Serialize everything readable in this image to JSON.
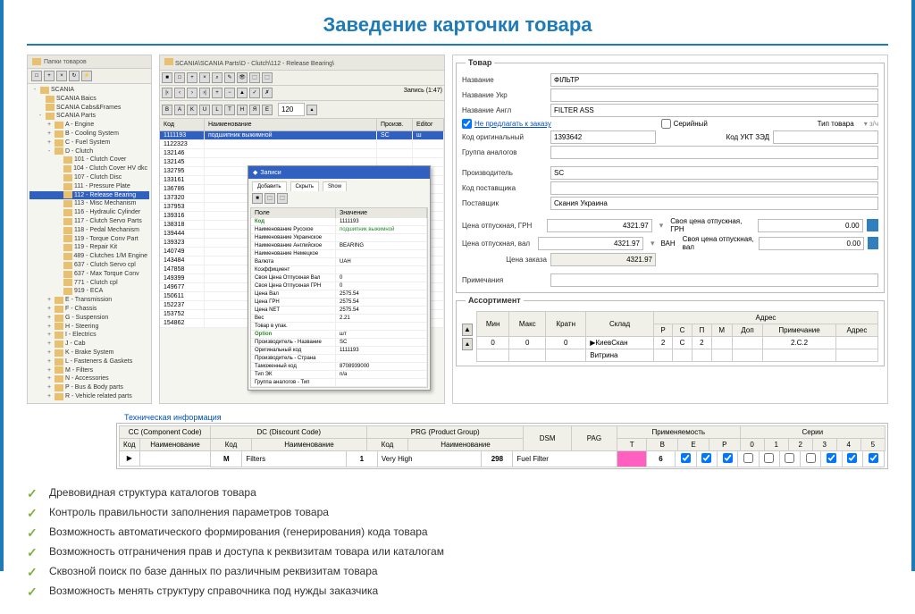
{
  "slide": {
    "title": "Заведение карточки товара"
  },
  "tree_panel": {
    "header": "Папки товаров",
    "root": "SCANIA",
    "items": [
      {
        "label": "SCANIA Baics",
        "level": 1,
        "exp": ""
      },
      {
        "label": "SCANIA Cabs&Frames",
        "level": 1,
        "exp": ""
      },
      {
        "label": "SCANIA Parts",
        "level": 1,
        "exp": "-"
      },
      {
        "label": "A - Engine",
        "level": 2,
        "exp": "+"
      },
      {
        "label": "B - Cooling System",
        "level": 2,
        "exp": "+"
      },
      {
        "label": "C - Fuel System",
        "level": 2,
        "exp": "+"
      },
      {
        "label": "D - Clutch",
        "level": 2,
        "exp": "-"
      },
      {
        "label": "101 - Clutch Cover",
        "level": 3,
        "exp": ""
      },
      {
        "label": "104 - Clutch Cover HV dkc",
        "level": 3,
        "exp": ""
      },
      {
        "label": "107 - Clutch Disc",
        "level": 3,
        "exp": ""
      },
      {
        "label": "111 - Pressure Plate",
        "level": 3,
        "exp": ""
      },
      {
        "label": "112 - Release Bearing",
        "level": 3,
        "exp": "",
        "selected": true
      },
      {
        "label": "113 - Misc Mechanism",
        "level": 3,
        "exp": ""
      },
      {
        "label": "116 - Hydraulic Cylinder",
        "level": 3,
        "exp": ""
      },
      {
        "label": "117 - Clutch Servo Parts",
        "level": 3,
        "exp": ""
      },
      {
        "label": "118 - Pedal Mechanism",
        "level": 3,
        "exp": ""
      },
      {
        "label": "119 - Torque Conv Part",
        "level": 3,
        "exp": ""
      },
      {
        "label": "119 - Repair Kit",
        "level": 3,
        "exp": ""
      },
      {
        "label": "489 - Clutches 1/M Engine",
        "level": 3,
        "exp": ""
      },
      {
        "label": "637 - Clutch Servo cpl",
        "level": 3,
        "exp": ""
      },
      {
        "label": "637 - Max Torque Conv",
        "level": 3,
        "exp": ""
      },
      {
        "label": "771 - Clutch cpl",
        "level": 3,
        "exp": ""
      },
      {
        "label": "919 - ECA",
        "level": 3,
        "exp": ""
      },
      {
        "label": "E - Transmission",
        "level": 2,
        "exp": "+"
      },
      {
        "label": "F - Chassis",
        "level": 2,
        "exp": "+"
      },
      {
        "label": "G - Suspension",
        "level": 2,
        "exp": "+"
      },
      {
        "label": "H - Steering",
        "level": 2,
        "exp": "+"
      },
      {
        "label": "I - Electrics",
        "level": 2,
        "exp": "+"
      },
      {
        "label": "J - Cab",
        "level": 2,
        "exp": "+"
      },
      {
        "label": "K - Brake System",
        "level": 2,
        "exp": "+"
      },
      {
        "label": "L - Fasteners & Gaskets",
        "level": 2,
        "exp": "+"
      },
      {
        "label": "M - Filters",
        "level": 2,
        "exp": "+"
      },
      {
        "label": "N - Accessories",
        "level": 2,
        "exp": "+"
      },
      {
        "label": "P - Bus & Body parts",
        "level": 2,
        "exp": "+"
      },
      {
        "label": "R - Vehicle related parts",
        "level": 2,
        "exp": "+"
      }
    ]
  },
  "center": {
    "breadcrumb": "SCANIA\\SCANIA Parts\\D - Clutch\\112 - Release Bearing\\",
    "record_info": "Запись (1:47)",
    "page_val": "120",
    "cols": {
      "kod": "Код",
      "name": "Наименование",
      "proizv": "Произв.",
      "editor": "Editor"
    },
    "rows": [
      {
        "kod": "1111193",
        "name": "подшипник выжимной",
        "proizv": "SC",
        "ed": "ш",
        "hl": true
      },
      {
        "kod": "1122323",
        "name": "",
        "proizv": "",
        "ed": ""
      },
      {
        "kod": "132146",
        "name": "",
        "proizv": "",
        "ed": ""
      },
      {
        "kod": "132145",
        "name": "",
        "proizv": "",
        "ed": ""
      },
      {
        "kod": "132795",
        "name": "",
        "proizv": "",
        "ed": ""
      },
      {
        "kod": "133161",
        "name": "",
        "proizv": "",
        "ed": ""
      },
      {
        "kod": "136786",
        "name": "",
        "proizv": "",
        "ed": ""
      },
      {
        "kod": "137320",
        "name": "",
        "proizv": "",
        "ed": ""
      },
      {
        "kod": "137953",
        "name": "",
        "proizv": "",
        "ed": ""
      },
      {
        "kod": "139316",
        "name": "",
        "proizv": "",
        "ed": ""
      },
      {
        "kod": "138318",
        "name": "",
        "proizv": "",
        "ed": ""
      },
      {
        "kod": "139444",
        "name": "",
        "proizv": "",
        "ed": ""
      },
      {
        "kod": "139323",
        "name": "",
        "proizv": "",
        "ed": ""
      },
      {
        "kod": "140749",
        "name": "",
        "proizv": "",
        "ed": ""
      },
      {
        "kod": "143484",
        "name": "",
        "proizv": "",
        "ed": ""
      },
      {
        "kod": "147858",
        "name": "",
        "proizv": "",
        "ed": ""
      },
      {
        "kod": "149399",
        "name": "",
        "proizv": "",
        "ed": ""
      },
      {
        "kod": "149677",
        "name": "",
        "proizv": "",
        "ed": ""
      },
      {
        "kod": "150611",
        "name": "",
        "proizv": "",
        "ed": ""
      },
      {
        "kod": "152237",
        "name": "",
        "proizv": "",
        "ed": ""
      },
      {
        "kod": "153752",
        "name": "",
        "proizv": "",
        "ed": ""
      },
      {
        "kod": "154862",
        "name": "",
        "proizv": "",
        "ed": ""
      }
    ]
  },
  "popup": {
    "title": "Записи",
    "tabs": [
      "Добавить",
      "Скрыть",
      "Show"
    ],
    "hdr": {
      "name": "Поле",
      "val": "Значение"
    },
    "rows": [
      {
        "name": "Код",
        "val": "1111193",
        "cat": true
      },
      {
        "name": "Наименование Русское",
        "val": "подшипник выжимной",
        "green": true
      },
      {
        "name": "Наименование Украинское",
        "val": ""
      },
      {
        "name": "Наименование Английское",
        "val": "BEARING"
      },
      {
        "name": "Наименование Немецкое",
        "val": ""
      },
      {
        "name": "Валюта",
        "val": "UAH"
      },
      {
        "name": "Коэффициент",
        "val": ""
      },
      {
        "name": "Своя Цена Отпускная Вал",
        "val": "0"
      },
      {
        "name": "Своя Цена Отпускная ГРН",
        "val": "0"
      },
      {
        "name": "Цена Вал",
        "val": "2575.54"
      },
      {
        "name": "Цена ГРН",
        "val": "2575.54"
      },
      {
        "name": "Цена NET",
        "val": "2575.54"
      },
      {
        "name": "Вес",
        "val": "2.21"
      },
      {
        "name": "Товар в упак.",
        "val": ""
      },
      {
        "name": "Option",
        "val": "шт",
        "cat": true
      },
      {
        "name": "Производитель - Название",
        "val": "SC"
      },
      {
        "name": "Оригинальный код",
        "val": "1111193"
      },
      {
        "name": "Производитель - Страна",
        "val": ""
      },
      {
        "name": "Таможенный код",
        "val": "8708939000"
      },
      {
        "name": "Тип ЭК",
        "val": "n/a"
      },
      {
        "name": "Группа аналогов - Тип",
        "val": ""
      }
    ]
  },
  "form": {
    "group_title": "Товар",
    "labels": {
      "name": "Название",
      "name_ukr": "Название Укр",
      "name_eng": "Название Англ",
      "no_offer": "Не предлагать к заказу",
      "serial": "Серийный",
      "type": "Тип товара",
      "unit": "з/ч",
      "orig_code": "Код оригинальный",
      "ukt": "Код УКТ ЗЭД",
      "analog_group": "Группа аналогов",
      "manufacturer": "Производитель",
      "supplier_code": "Код поставщика",
      "supplier": "Поставщик",
      "price_uah": "Цена отпускная, ГРН",
      "price_val": "Цена отпускная, вал",
      "price_order": "Цена заказа",
      "currency": "ВАН",
      "own_price_uah": "Своя цена отпускная, ГРН",
      "own_price_val": "Своя цена отпускная, вал",
      "notes": "Примечания",
      "assortment_title": "Ассортимент"
    },
    "values": {
      "name": "ФІЛЬТР",
      "name_eng": "FILTER ASS",
      "orig_code": "1393642",
      "manufacturer": "SC",
      "supplier": "Скания Украина",
      "price_uah": "4321.97",
      "price_val": "4321.97",
      "price_order": "4321.97",
      "own_price_uah": "0.00",
      "own_price_val": "0.00"
    },
    "assort_headers": {
      "min": "Мин",
      "max": "Макс",
      "mult": "Кратн",
      "sklad": "Склад",
      "address": "Адрес",
      "r": "Р",
      "s": "С",
      "p": "П",
      "m": "М",
      "dop": "Доп",
      "note": "Примечание",
      "addr": "Адрес"
    },
    "assort_rows": [
      {
        "min": "0",
        "max": "0",
        "mult": "0",
        "sklad": "КиевСкан",
        "r": "2",
        "s": "С",
        "p": "2",
        "m": "",
        "dop": "",
        "note": "2.C.2",
        "addr": ""
      },
      {
        "min": "",
        "max": "",
        "mult": "",
        "sklad": "Витрина",
        "r": "",
        "s": "",
        "p": "",
        "m": "",
        "dop": "",
        "note": "",
        "addr": ""
      }
    ]
  },
  "tech": {
    "title": "Техническая информация",
    "headers": {
      "cc": "CC (Component Code)",
      "dc": "DC (Discount Code)",
      "prg": "PRG (Product Group)",
      "dsm": "DSM",
      "pag": "PAG",
      "applic": "Применяемость",
      "series": "Серии",
      "kod": "Код",
      "name": "Наименование",
      "T": "T",
      "B": "B",
      "E": "E",
      "P": "P",
      "s0": "0",
      "s1": "1",
      "s2": "2",
      "s3": "3",
      "s4": "4",
      "s5": "5"
    },
    "row": {
      "cc_kod": "M",
      "cc_name": "Filters",
      "dc_kod": "1",
      "dc_name": "Very High",
      "prg_kod": "298",
      "prg_name": "Fuel Filter",
      "dsm": "",
      "pag": "6",
      "T": true,
      "B": true,
      "E": true,
      "P": false,
      "s0": false,
      "s1": false,
      "s2": false,
      "s3": true,
      "s4": true,
      "s5": true
    }
  },
  "bullets": [
    "Древовидная структура каталогов товара",
    "Контроль правильности заполнения параметров товара",
    "Возможность автоматического формирования (генерирования) кода товара",
    "Возможность отграничения прав и доступа к реквизитам товара или каталогам",
    "Сквозной поиск по базе данных по различным реквизитам товара",
    "Возможность менять структуру справочника под нужды заказчика"
  ]
}
